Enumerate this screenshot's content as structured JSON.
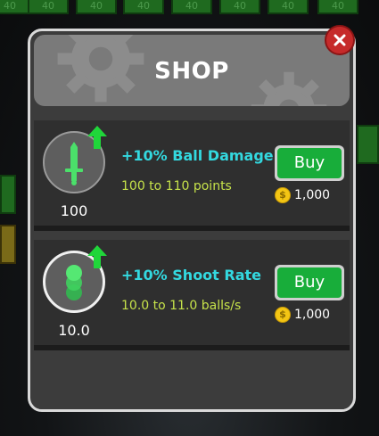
{
  "background": {
    "brick_labels": [
      "40",
      "40",
      "40",
      "40",
      "40",
      "40",
      "40",
      "40"
    ]
  },
  "shop": {
    "title": "SHOP",
    "close_icon": "close-icon",
    "items": [
      {
        "name": "+10% Ball Damage",
        "description": "100  to  110  points",
        "level": "100",
        "buy_label": "Buy",
        "price": "1,000",
        "icon": "sword-icon"
      },
      {
        "name": "+10% Shoot Rate",
        "description": "10.0  to  11.0  balls/s",
        "level": "10.0",
        "buy_label": "Buy",
        "price": "1,000",
        "icon": "balls-stack-icon"
      }
    ]
  },
  "colors": {
    "accent_name": "#33d9e0",
    "accent_desc": "#c6e24a",
    "buy_green": "#18ad3a",
    "close_red": "#c62a2a",
    "coin_gold": "#f3c514"
  }
}
